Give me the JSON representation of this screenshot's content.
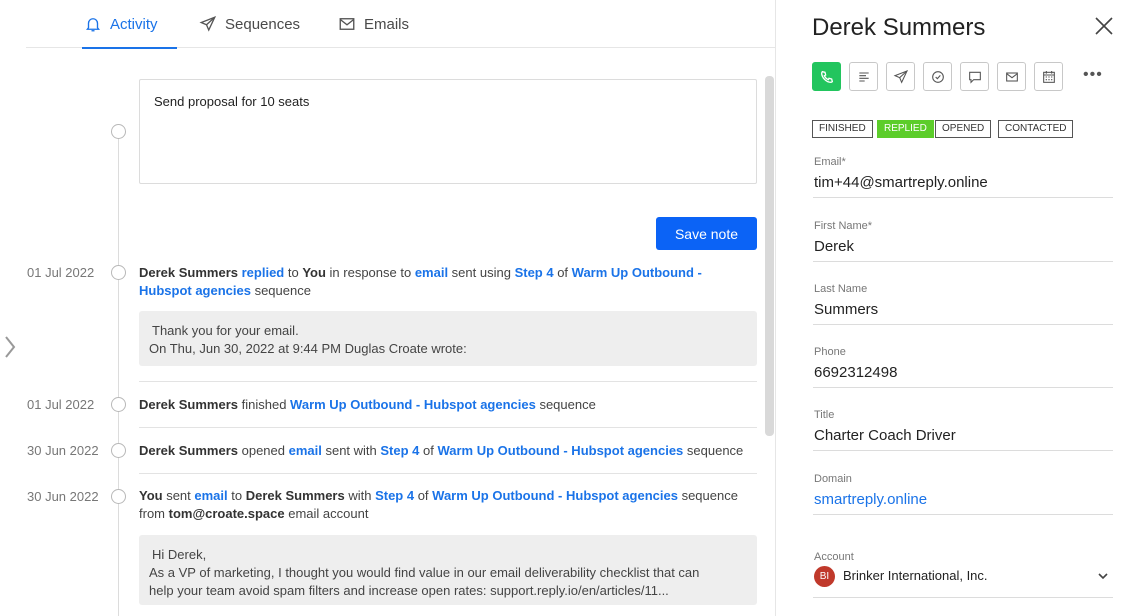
{
  "tabs": [
    {
      "label": "Activity",
      "icon": "bell-icon",
      "active": true
    },
    {
      "label": "Sequences",
      "icon": "send-icon",
      "active": false
    },
    {
      "label": "Emails",
      "icon": "mail-icon",
      "active": false
    }
  ],
  "note": {
    "text": "Send proposal for 10 seats",
    "save_label": "Save note"
  },
  "activity": [
    {
      "date": "01 Jul 2022",
      "parts": [
        "Derek Summers",
        " replied",
        " to ",
        "You",
        " in response to ",
        "email",
        " sent using ",
        "Step 4",
        " of ",
        "Warm Up Outbound -",
        "Hubspot agencies",
        " sequence"
      ],
      "quote_line1": "Thank you for your email.",
      "quote_line2": "On Thu, Jun 30, 2022 at 9:44 PM Duglas Croate wrote:"
    },
    {
      "date": "01 Jul 2022",
      "parts": [
        "Derek Summers",
        " finished ",
        "Warm Up Outbound - Hubspot agencies",
        " sequence"
      ]
    },
    {
      "date": "30 Jun 2022",
      "parts": [
        "Derek Summers",
        " opened ",
        "email",
        " sent with ",
        "Step 4",
        " of ",
        "Warm Up Outbound - Hubspot agencies",
        " sequence"
      ]
    },
    {
      "date": "30 Jun 2022",
      "parts": [
        "You",
        " sent ",
        "email",
        " to ",
        "Derek Summers",
        " with ",
        "Step 4",
        " of ",
        "Warm Up Outbound - Hubspot agencies",
        " sequence",
        "from ",
        "tom@croate.space",
        " email account"
      ],
      "quote_line1": "Hi Derek,",
      "quote_line2": "As a VP of marketing, I thought you would find value in our email deliverability checklist that can",
      "quote_line3": "help your team avoid spam filters and increase open rates: support.reply.io/en/articles/11..."
    }
  ],
  "contact": {
    "name": "Derek Summers",
    "statuses": [
      "FINISHED",
      "REPLIED",
      "OPENED",
      "CONTACTED"
    ],
    "fields": [
      {
        "label": "Email",
        "required": "*",
        "value": "tim+44@smartreply.online"
      },
      {
        "label": "First Name",
        "required": "*",
        "value": "Derek"
      },
      {
        "label": "Last Name",
        "value": "Summers"
      },
      {
        "label": "Phone",
        "value": "6692312498"
      },
      {
        "label": "Title",
        "value": "Charter Coach Driver"
      },
      {
        "label": "Domain",
        "value": "smartreply.online"
      }
    ],
    "account": {
      "label": "Account",
      "initials": "BI",
      "name": "Brinker International, Inc."
    },
    "more": "•••"
  },
  "colors": {
    "accent": "#1a73e8",
    "primary_button": "#0b63f6",
    "call_green": "#22c55e",
    "replied_green": "#5ccd2a",
    "account_badge": "#c0392b"
  }
}
